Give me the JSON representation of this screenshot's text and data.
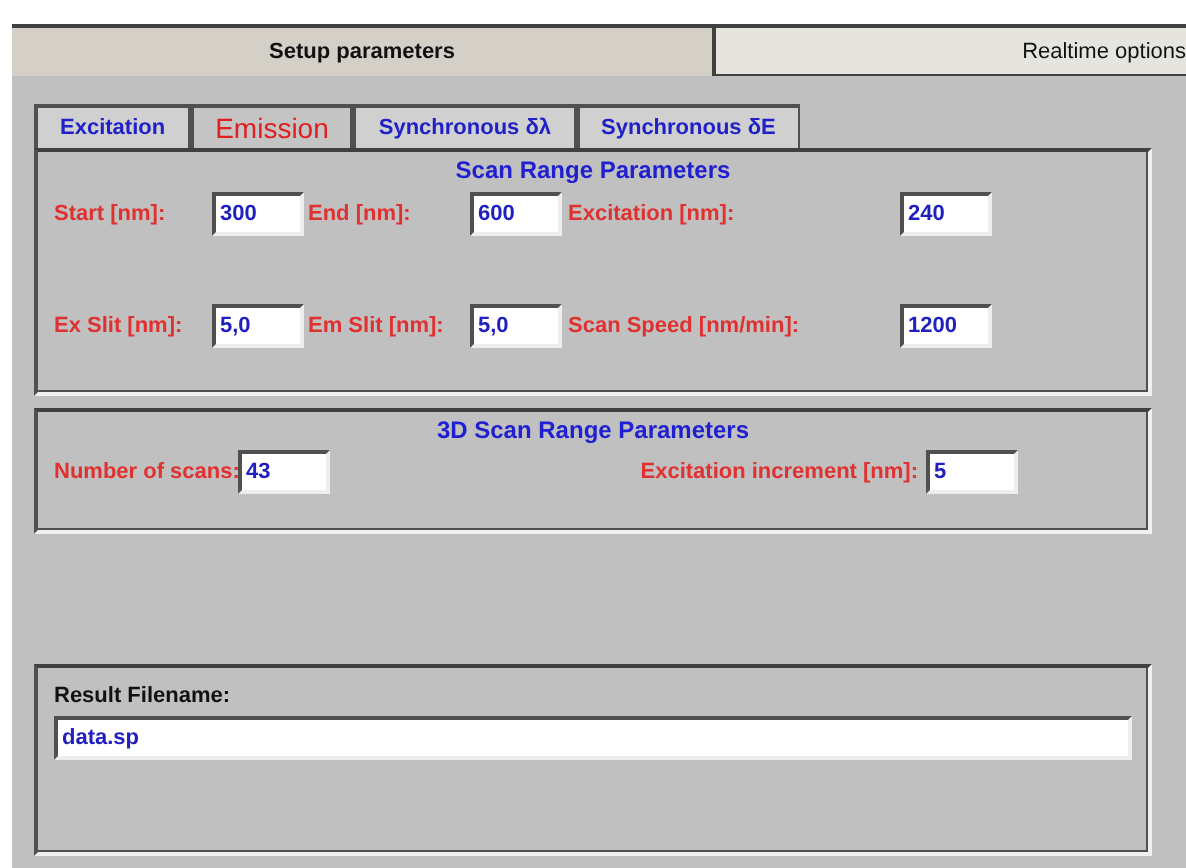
{
  "main_tabs": [
    {
      "label": "Setup parameters",
      "selected": true
    },
    {
      "label": "Realtime options",
      "selected": false
    }
  ],
  "mode_tabs": [
    {
      "label": "Excitation",
      "selected": false
    },
    {
      "label": "Emission",
      "selected": true
    },
    {
      "label": "Synchronous δλ",
      "selected": false
    },
    {
      "label": "Synchronous δE",
      "selected": false
    }
  ],
  "scan_range": {
    "title": "Scan Range Parameters",
    "rows": [
      [
        {
          "label": "Start [nm]:",
          "value": "300"
        },
        {
          "label": "End [nm]:",
          "value": "600"
        },
        {
          "label": "Excitation [nm]:",
          "value": "240"
        }
      ],
      [
        {
          "label": "Ex Slit [nm]:",
          "value": "5,0"
        },
        {
          "label": "Em Slit [nm]:",
          "value": "5,0"
        },
        {
          "label": "Scan Speed [nm/min]:",
          "value": "1200"
        }
      ]
    ]
  },
  "scan_3d": {
    "title": "3D Scan Range Parameters",
    "fields": [
      {
        "label": "Number of scans:",
        "value": "43"
      },
      {
        "label": "Excitation increment [nm]:",
        "value": "5"
      }
    ]
  },
  "result": {
    "label": "Result Filename:",
    "value": "data.sp"
  }
}
